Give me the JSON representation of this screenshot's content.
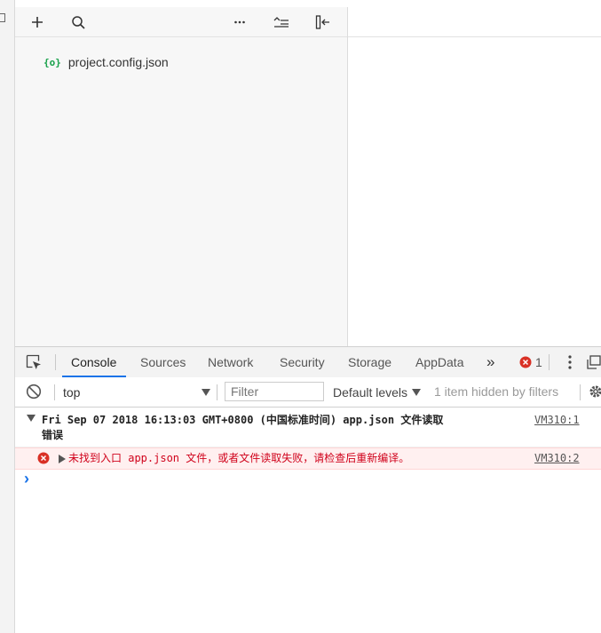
{
  "file_tree": {
    "items": [
      {
        "name": "project.config.json",
        "icon": "{o}"
      }
    ]
  },
  "devtools": {
    "tabs": [
      "Console",
      "Sources",
      "Network",
      "Security",
      "Storage",
      "AppData"
    ],
    "more_tabs": "»",
    "error_count": "1",
    "context_value": "top",
    "filter_placeholder": "Filter",
    "levels_label": "Default levels",
    "hidden_text": "1 item hidden by filters",
    "messages": [
      {
        "text_line1": "Fri Sep 07 2018 16:13:03 GMT+0800 (中国标准时间)  app.json 文件读取",
        "text_line2": "错误",
        "source": "VM310:1"
      },
      {
        "text": "未找到入口 app.json 文件，或者文件读取失败，请检查后重新编译。",
        "source": "VM310:2"
      }
    ],
    "prompt": "›"
  },
  "colors": {
    "accent": "#1a73e8",
    "error": "#d93025",
    "json_icon": "#17a04a"
  }
}
